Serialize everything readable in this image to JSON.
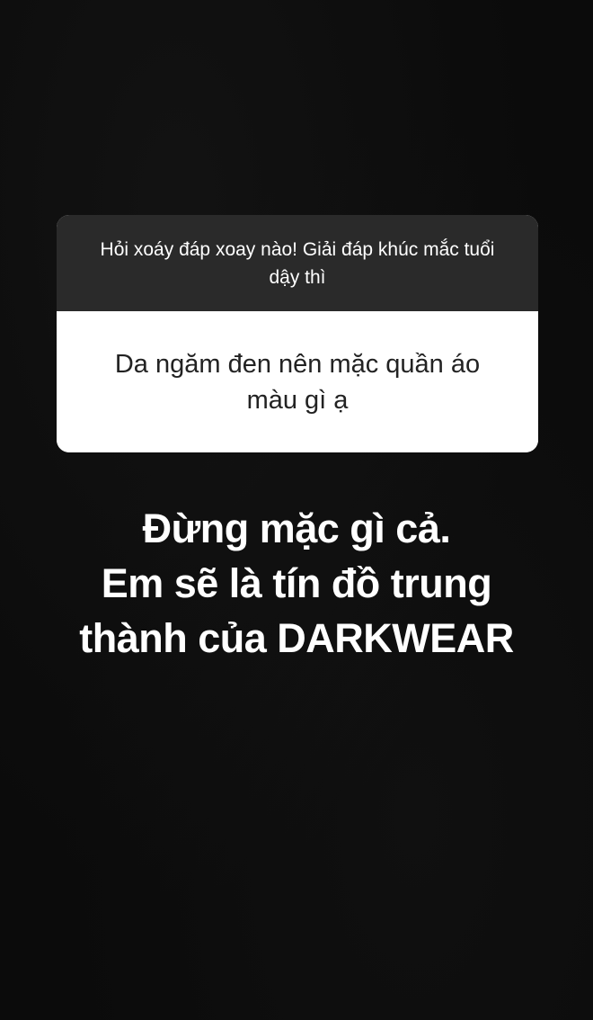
{
  "story": {
    "question_sticker": {
      "prompt": "Hỏi xoáy đáp xoay nào! Giải đáp khúc mắc tuổi dậy thì",
      "question": "Da ngăm đen nên mặc quần áo màu gì ạ"
    },
    "answer_text": {
      "lines": [
        "Đừng mặc gì cả.",
        "Em sẽ là tín đồ trung",
        "thành của DARKWEAR"
      ]
    },
    "colors": {
      "background": "#0b0b0b",
      "sticker_header": "#2a2a2a",
      "sticker_body": "#ffffff",
      "answer_text": "#ffffff"
    }
  }
}
